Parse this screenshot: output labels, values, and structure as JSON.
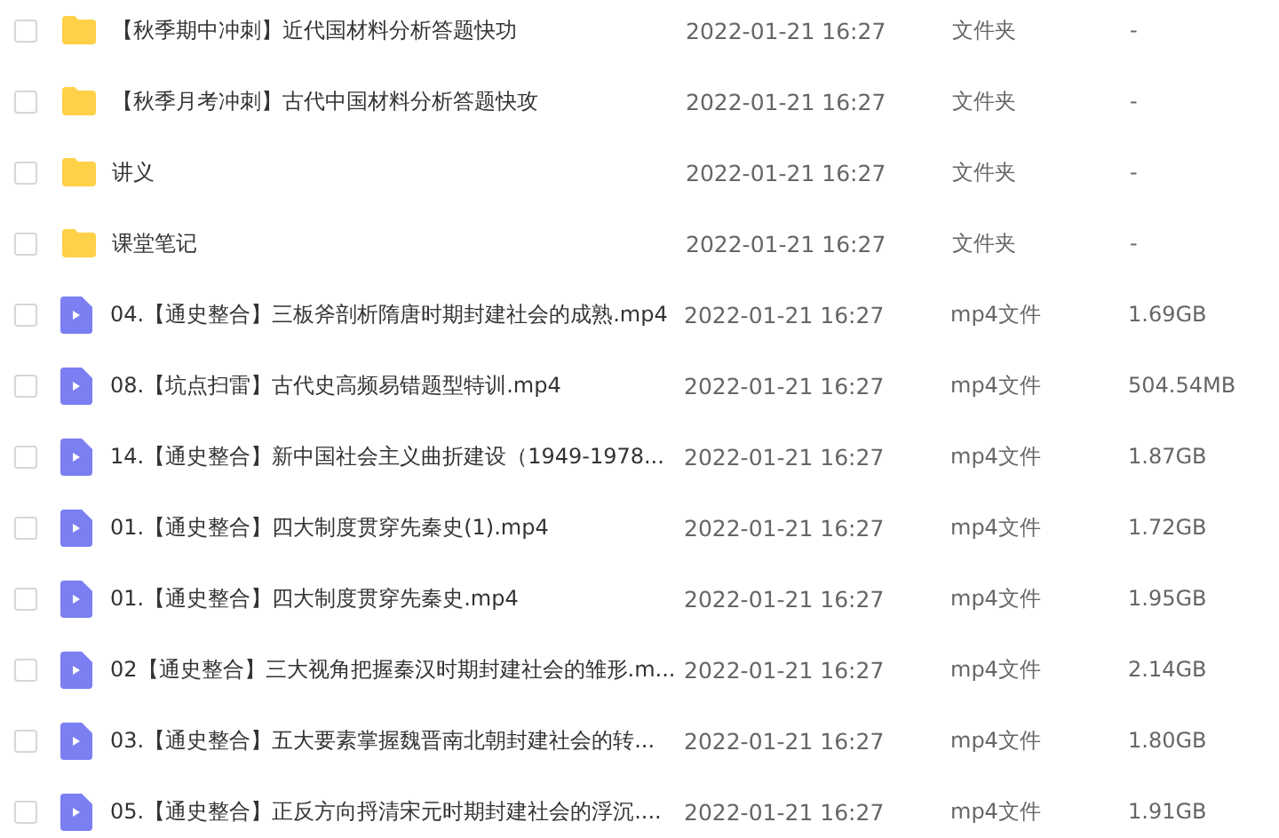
{
  "files": [
    {
      "kind": "folder",
      "checked": false,
      "name": "【秋季期中冲刺】近代国材料分析答题快功",
      "modified": "2022-01-21 16:27",
      "type": "文件夹",
      "size": "-"
    },
    {
      "kind": "folder",
      "checked": false,
      "name": "【秋季月考冲刺】古代中国材料分析答题快攻",
      "modified": "2022-01-21 16:27",
      "type": "文件夹",
      "size": "-"
    },
    {
      "kind": "folder",
      "checked": false,
      "name": "讲义",
      "modified": "2022-01-21 16:27",
      "type": "文件夹",
      "size": "-"
    },
    {
      "kind": "folder",
      "checked": false,
      "name": "课堂笔记",
      "modified": "2022-01-21 16:27",
      "type": "文件夹",
      "size": "-"
    },
    {
      "kind": "video",
      "checked": false,
      "name": "04.【通史整合】三板斧剖析隋唐时期封建社会的成熟.mp4",
      "modified": "2022-01-21 16:27",
      "type": "mp4文件",
      "size": "1.69GB"
    },
    {
      "kind": "video",
      "checked": false,
      "name": "08.【坑点扫雷】古代史高频易错题型特训.mp4",
      "modified": "2022-01-21 16:27",
      "type": "mp4文件",
      "size": "504.54MB"
    },
    {
      "kind": "video",
      "checked": false,
      "name": "14.【通史整合】新中国社会主义曲折建设（1949-1978...",
      "modified": "2022-01-21 16:27",
      "type": "mp4文件",
      "size": "1.87GB"
    },
    {
      "kind": "video",
      "checked": false,
      "name": "01.【通史整合】四大制度贯穿先秦史(1).mp4",
      "modified": "2022-01-21 16:27",
      "type": "mp4文件",
      "size": "1.72GB"
    },
    {
      "kind": "video",
      "checked": false,
      "name": "01.【通史整合】四大制度贯穿先秦史.mp4",
      "modified": "2022-01-21 16:27",
      "type": "mp4文件",
      "size": "1.95GB"
    },
    {
      "kind": "video",
      "checked": false,
      "name": "02【通史整合】三大视角把握秦汉时期封建社会的雏形.m...",
      "modified": "2022-01-21 16:27",
      "type": "mp4文件",
      "size": "2.14GB"
    },
    {
      "kind": "video",
      "checked": false,
      "name": "03.【通史整合】五大要素掌握魏晋南北朝封建社会的转...",
      "modified": "2022-01-21 16:27",
      "type": "mp4文件",
      "size": "1.80GB"
    },
    {
      "kind": "video",
      "checked": false,
      "name": "05.【通史整合】正反方向捋清宋元时期封建社会的浮沉....",
      "modified": "2022-01-21 16:27",
      "type": "mp4文件",
      "size": "1.91GB"
    }
  ]
}
